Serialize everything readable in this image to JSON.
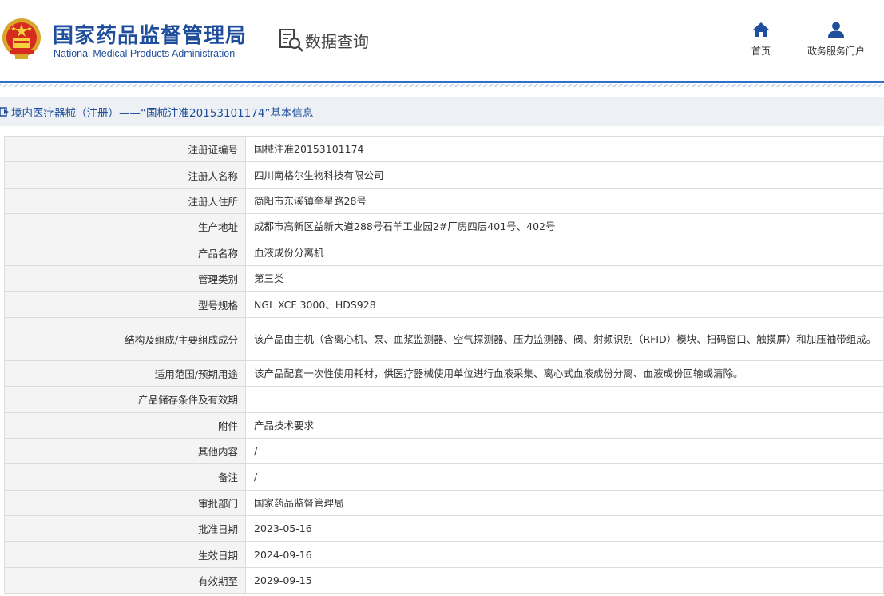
{
  "header": {
    "org_cn": "国家药品监督管理局",
    "org_en": "National Medical Products Administration",
    "data_query": "数据查询",
    "nav": {
      "home_label": "首页",
      "gov_label": "政务服务门户"
    }
  },
  "colors": {
    "brand_blue": "#1f4e9c",
    "divider_blue": "#2f6fc7",
    "label_bg": "#f4f4f4",
    "border": "#dcdcdc",
    "crumb_bg": "#edf1f5"
  },
  "icons": [
    "national-emblem-icon",
    "data-query-icon",
    "home-icon",
    "user-icon",
    "crumb-arrow-icon"
  ],
  "breadcrumb": {
    "text": "境内医疗器械（注册）——“国械注准20153101174”基本信息"
  },
  "details": [
    {
      "label": "注册证编号",
      "value": "国械注准20153101174"
    },
    {
      "label": "注册人名称",
      "value": "四川南格尔生物科技有限公司"
    },
    {
      "label": "注册人住所",
      "value": "简阳市东溪镇奎星路28号"
    },
    {
      "label": "生产地址",
      "value": "成都市高新区益新大道288号石羊工业园2#厂房四层401号、402号"
    },
    {
      "label": "产品名称",
      "value": "血液成份分离机"
    },
    {
      "label": "管理类别",
      "value": "第三类"
    },
    {
      "label": "型号规格",
      "value": "NGL XCF 3000、HDS928"
    },
    {
      "label": "结构及组成/主要组成成分",
      "value": "该产品由主机（含离心机、泵、血浆监测器、空气探测器、压力监测器、阀、射频识别（RFID）模块、扫码窗口、触摸屏）和加压袖带组成。"
    },
    {
      "label": "适用范围/预期用途",
      "value": "该产品配套一次性使用耗材，供医疗器械使用单位进行血液采集、离心式血液成份分离、血液成份回输或清除。"
    },
    {
      "label": "产品储存条件及有效期",
      "value": ""
    },
    {
      "label": "附件",
      "value": "产品技术要求"
    },
    {
      "label": "其他内容",
      "value": "/"
    },
    {
      "label": "备注",
      "value": "/"
    },
    {
      "label": "审批部门",
      "value": "国家药品监督管理局"
    },
    {
      "label": "批准日期",
      "value": "2023-05-16"
    },
    {
      "label": "生效日期",
      "value": "2024-09-16"
    },
    {
      "label": "有效期至",
      "value": "2029-09-15"
    }
  ]
}
